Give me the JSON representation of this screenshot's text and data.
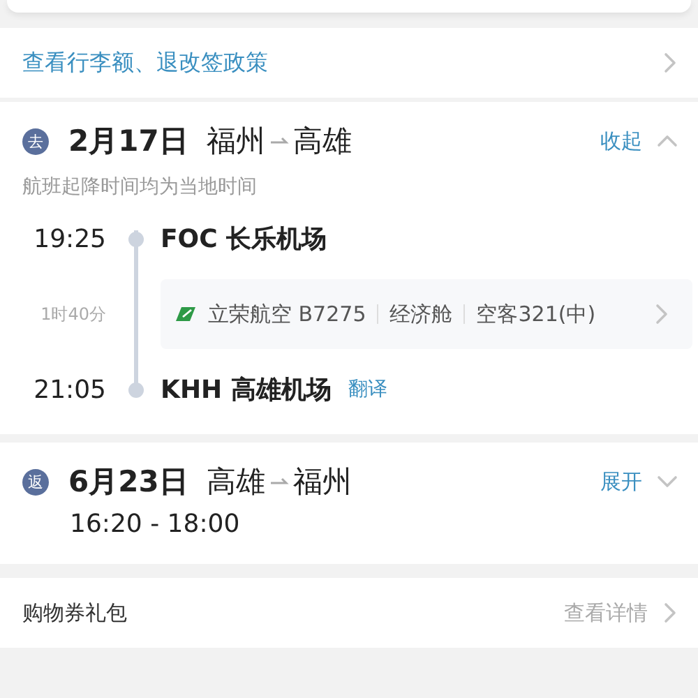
{
  "policy_link": {
    "label": "查看行李额、退改签政策"
  },
  "segments": [
    {
      "badge": "去",
      "date": "2月17日",
      "from": "福州",
      "to": "高雄",
      "toggle": "收起",
      "expanded": true,
      "note": "航班起降时间均为当地时间",
      "departure": {
        "time": "19:25",
        "airport": "FOC 长乐机场"
      },
      "duration": "1时40分",
      "flight": {
        "airline": "立荣航空 B7275",
        "cabin": "经济舱",
        "aircraft": "空客321(中)"
      },
      "arrival": {
        "time": "21:05",
        "airport": "KHH 高雄机场",
        "action": "翻译"
      }
    },
    {
      "badge": "返",
      "date": "6月23日",
      "from": "高雄",
      "to": "福州",
      "toggle": "展开",
      "expanded": false,
      "times": "16:20 - 18:00"
    }
  ],
  "gift": {
    "label": "购物券礼包",
    "action": "查看详情"
  }
}
